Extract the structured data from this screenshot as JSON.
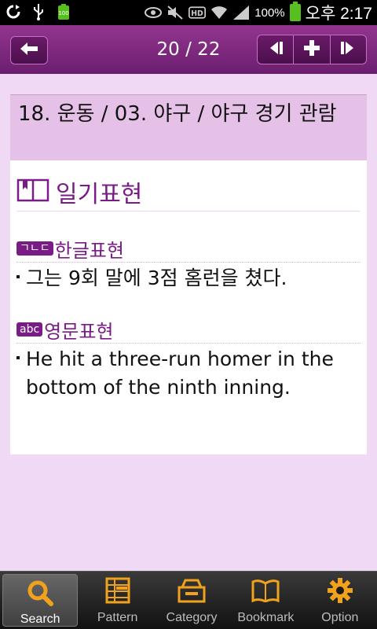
{
  "status_bar": {
    "battery_percent": "100%",
    "time": "오후 2:17",
    "icons": [
      "sync-icon",
      "usb-icon",
      "battery-small-icon",
      "eye-icon",
      "mute-icon",
      "hd-icon",
      "wifi-icon",
      "signal-icon",
      "battery-icon"
    ]
  },
  "header": {
    "page_counter": "20 / 22",
    "back_icon": "arrow-left-icon",
    "nav_icons": [
      "prev-icon",
      "plus-icon",
      "next-icon"
    ]
  },
  "content": {
    "breadcrumb": "18. 운동 / 03. 야구 / 야구 경기 관람",
    "section_title": "일기표현",
    "korean": {
      "badge": "ㄱㄴㄷ",
      "heading": "한글표현",
      "sentence": "그는 9회 말에 3점 홈런을 쳤다."
    },
    "english": {
      "badge": "abc",
      "heading": "영문표현",
      "sentence": "He hit a three-run homer in the bottom of the ninth inning."
    }
  },
  "tabs": [
    {
      "label": "Search",
      "icon": "search-icon",
      "active": true
    },
    {
      "label": "Pattern",
      "icon": "pattern-icon",
      "active": false
    },
    {
      "label": "Category",
      "icon": "category-icon",
      "active": false
    },
    {
      "label": "Bookmark",
      "icon": "bookmark-icon",
      "active": false
    },
    {
      "label": "Option",
      "icon": "gear-icon",
      "active": false
    }
  ],
  "colors": {
    "accent": "#7a1c86",
    "header": "#7e2a80",
    "background": "#f0d9f4",
    "tab_icon": "#f0a21c"
  }
}
